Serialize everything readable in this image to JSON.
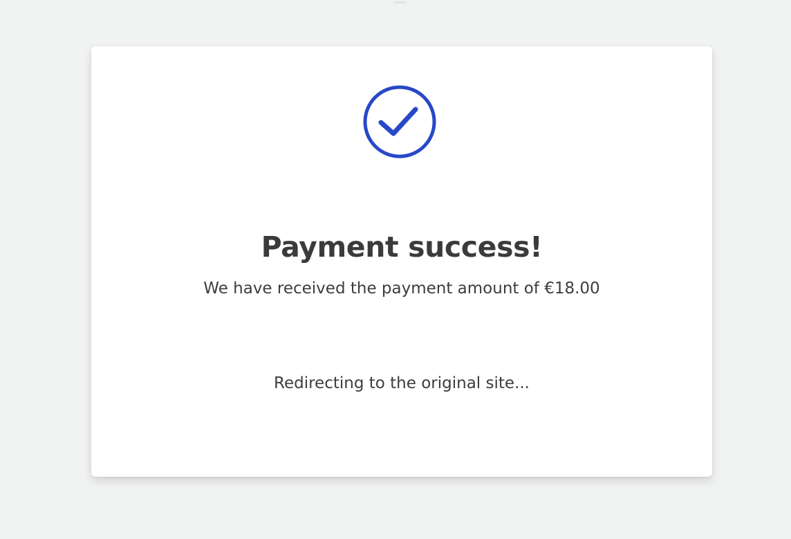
{
  "status": {
    "icon": "check-circle-icon",
    "accent_color": "#2748c8"
  },
  "content": {
    "title": "Payment success!",
    "message": "We have received the payment amount of €18.00",
    "redirect": "Redirecting to the original site..."
  }
}
